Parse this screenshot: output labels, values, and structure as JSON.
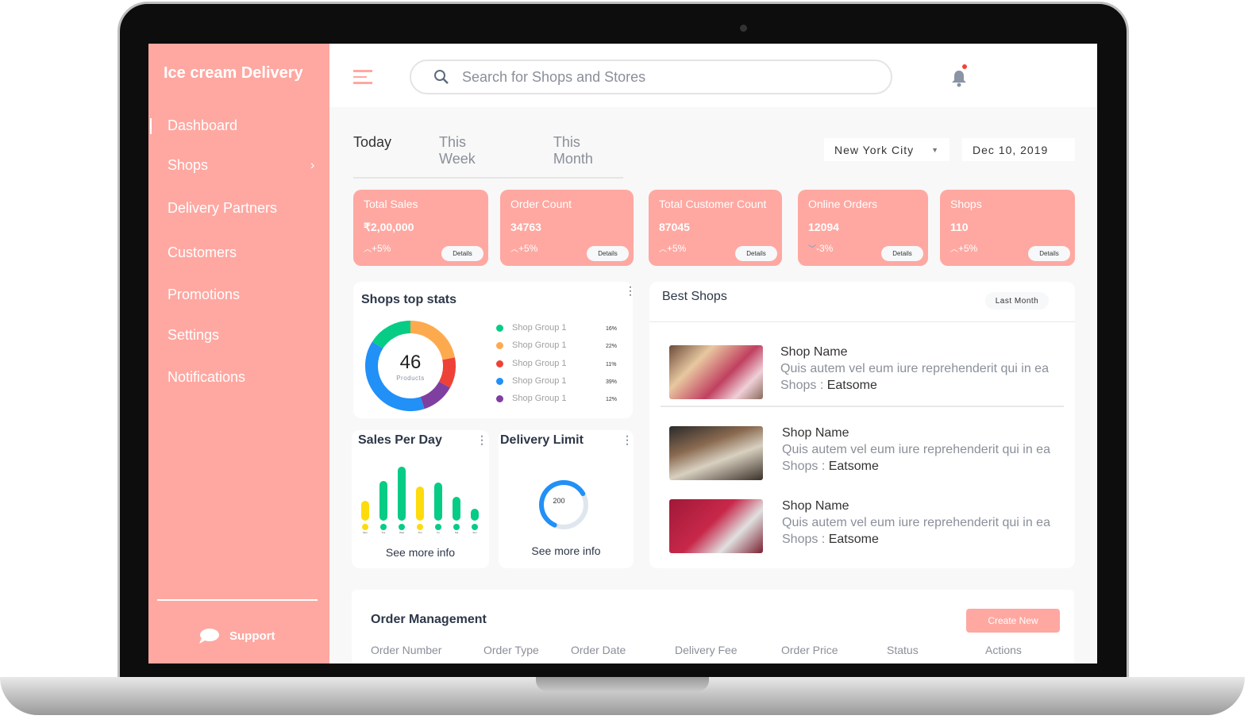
{
  "sidebar": {
    "brand": "Ice cream Delivery",
    "items": [
      "Dashboard",
      "Shops",
      "Delivery Partners",
      "Customers",
      "Promotions",
      "Settings",
      "Notifications"
    ],
    "support": "Support",
    "active": "Dashboard"
  },
  "header": {
    "search_placeholder": "Search for Shops and Stores"
  },
  "tabs": [
    "Today",
    "This Week",
    "This Month"
  ],
  "filters": {
    "city": "New York City",
    "date": "Dec 10, 2019"
  },
  "stats": [
    {
      "title": "Total Sales",
      "value": "₹2,00,000",
      "change": "+5%",
      "trend": "up",
      "details": "Details"
    },
    {
      "title": "Order Count",
      "value": "34763",
      "change": "+5%",
      "trend": "up",
      "details": "Details"
    },
    {
      "title": "Total Customer Count",
      "value": "87045",
      "change": "+5%",
      "trend": "up",
      "details": "Details"
    },
    {
      "title": "Online Orders",
      "value": "12094",
      "change": "-3%",
      "trend": "down",
      "details": "Details"
    },
    {
      "title": "Shops",
      "value": "110",
      "change": "+5%",
      "trend": "up",
      "details": "Details"
    }
  ],
  "top_stats": {
    "title": "Shops top  stats",
    "center_value": "46",
    "center_label": "Products",
    "groups": [
      {
        "name": "Shop Group 1",
        "pct": "16%",
        "value": 16,
        "color": "#07cc86"
      },
      {
        "name": "Shop Group 1",
        "pct": "22%",
        "value": 22,
        "color": "#fdaa4f"
      },
      {
        "name": "Shop Group 1",
        "pct": "11%",
        "value": 11,
        "color": "#ee4138"
      },
      {
        "name": "Shop Group 1",
        "pct": "39%",
        "value": 39,
        "color": "#2190f7"
      },
      {
        "name": "Shop Group 1",
        "pct": "12%",
        "value": 12,
        "color": "#7f3fa0"
      }
    ]
  },
  "sales_per_day": {
    "title": "Sales Per Day",
    "days": [
      "Mon",
      "Tue",
      "Wed",
      "Thu",
      "Fri",
      "Sat",
      "Sun"
    ],
    "values": [
      25,
      50,
      68,
      43,
      48,
      30,
      15
    ],
    "colors": [
      "#fddb0d",
      "#07cc86",
      "#07cc86",
      "#fddb0d",
      "#07cc86",
      "#07cc86",
      "#07cc86"
    ],
    "more": "See more info"
  },
  "delivery_limit": {
    "title": "Delivery Limit",
    "value": "200",
    "fraction": 0.6,
    "more": "See more info"
  },
  "best_shops": {
    "title": "Best Shops",
    "filter": "Last Month",
    "items": [
      {
        "name": "Shop Name",
        "desc": "Quis autem vel eum iure reprehenderit qui in ea",
        "shops_label": "Shops : ",
        "shops_value": "Eatsome"
      },
      {
        "name": "Shop Name",
        "desc": "Quis autem vel eum iure reprehenderit qui in ea",
        "shops_label": "Shops : ",
        "shops_value": "Eatsome"
      },
      {
        "name": "Shop Name",
        "desc": "Quis autem vel eum iure reprehenderit qui in ea",
        "shops_label": "Shops : ",
        "shops_value": "Eatsome"
      }
    ]
  },
  "orders": {
    "title": "Order Management",
    "create": "Create New",
    "columns": [
      "Order Number",
      "Order Type",
      "Order Date",
      "Delivery Fee",
      "Order Price",
      "Status",
      "Actions"
    ]
  }
}
